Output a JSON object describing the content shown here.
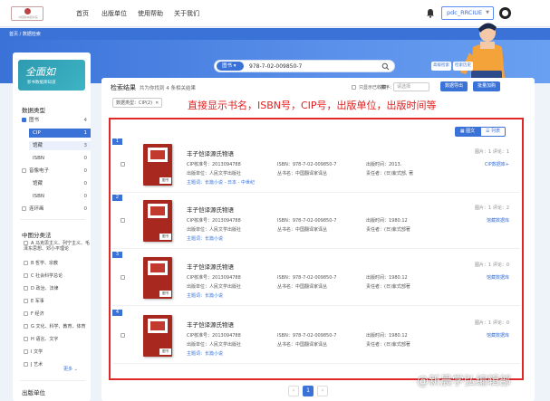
{
  "topbar": {
    "logo_text": "中国版本图书馆",
    "nav": [
      "首页",
      "出版单位",
      "使用帮助",
      "关于我们"
    ],
    "user": "pdc_RRCIUE"
  },
  "breadcrumb": "首页 / 数据检索",
  "search": {
    "category": "图书",
    "value": "978-7-02-009850-7",
    "buttons": [
      "高级检索",
      "检索历史"
    ]
  },
  "sidebar": {
    "banner_title": "全面如",
    "banner_sub": "新书数据库知道",
    "type_title": "数据类型",
    "types": [
      {
        "label": "图书",
        "count": "4",
        "checked": true,
        "style": "top"
      },
      {
        "label": "CIP",
        "count": "1",
        "style": "active"
      },
      {
        "label": "馆藏",
        "count": "3",
        "style": "light"
      },
      {
        "label": "ISBN",
        "count": "0",
        "style": "sub"
      },
      {
        "label": "音像电子",
        "count": "0",
        "checked": false,
        "style": "top"
      },
      {
        "label": "馆藏",
        "count": "0",
        "style": "sub"
      },
      {
        "label": "ISBN",
        "count": "0",
        "style": "sub"
      },
      {
        "label": "连环画",
        "count": "0",
        "checked": false,
        "style": "top"
      }
    ],
    "class_title": "中图分类法",
    "classes": [
      "A 马克思主义、列宁主义、毛泽东思想、邓小平理论",
      "B 哲学、宗教",
      "C 社会科学总论",
      "D 政治、法律",
      "E 军事",
      "F 经济",
      "G 文化、科学、教育、体育",
      "H 语言、文字",
      "I 文学",
      "J 艺术"
    ],
    "more": "更多",
    "publisher_title": "出版单位"
  },
  "main": {
    "result_title": "检索结果",
    "result_count": "共为你找到 4 条相关结果",
    "opt_collected": "只显示已收藏",
    "sort_label": "排序：",
    "sort_value": "请选择",
    "btn_export": "数据导出",
    "btn_add": "批量加购",
    "filter_label": "数据类型：CIP(2)",
    "annotation": "直接显示书名，ISBN号，CIP号，出版单位，出版时间等",
    "view_grid": "图文",
    "view_list": "列表"
  },
  "results": [
    {
      "num": "1",
      "title": "丰子恺译源氏物语",
      "cip": "CIP核准号：2013094788",
      "pub": "出版单位：人民文学出版社",
      "subject": "主题词：长篇小说 - 日本 - 中世纪",
      "isbn": "ISBN：978-7-02-009850-7",
      "series": "丛书名：中国翻译家译丛",
      "date": "出版时间：2013.",
      "author": "责任者：(日)紫式部, 著",
      "meta": "图片：1  评论：1",
      "link": "CIP数据库+",
      "cover": "图书"
    },
    {
      "num": "2",
      "title": "丰子恺译源氏物语",
      "cip": "CIP核准号：2013094788",
      "pub": "出版单位：人民文学出版社",
      "subject": "主题词：长篇小说",
      "isbn": "ISBN：978-7-02-009850-7",
      "series": "丛书名：中国翻译家译丛",
      "date": "出版时间：1980.12",
      "author": "责任者：(日)紫式部著",
      "meta": "图片：1  评论：2",
      "link": "馆藏数据库",
      "cover": "图书"
    },
    {
      "num": "3",
      "title": "丰子恺译源氏物语",
      "cip": "CIP核准号：2013094788",
      "pub": "出版单位：人民文学出版社",
      "subject": "主题词：长篇小说",
      "isbn": "ISBN：978-7-02-009850-7",
      "series": "丛书名：中国翻译家译丛",
      "date": "出版时间：1980.12",
      "author": "责任者：(日)紫式部著",
      "meta": "图片：1  评论：0",
      "link": "馆藏数据库",
      "cover": "图书"
    },
    {
      "num": "4",
      "title": "丰子恺译源氏物语",
      "cip": "CIP核准号：2013094788",
      "pub": "出版单位：人民文学出版社",
      "subject": "主题词：长篇小说",
      "isbn": "ISBN：978-7-02-009850-7",
      "series": "丛书名：中国翻译家译丛",
      "date": "出版时间：1980.12",
      "author": "责任者：(日)紫式部著",
      "meta": "图片：1  评论：0",
      "link": "馆藏数据库",
      "cover": "图书"
    }
  ],
  "pager": {
    "prev": "‹",
    "current": "1",
    "next": "›"
  },
  "watermark": "@新晨学弘编辑部",
  "colors": {
    "accent": "#3a72d8",
    "annotation": "#e02020"
  }
}
